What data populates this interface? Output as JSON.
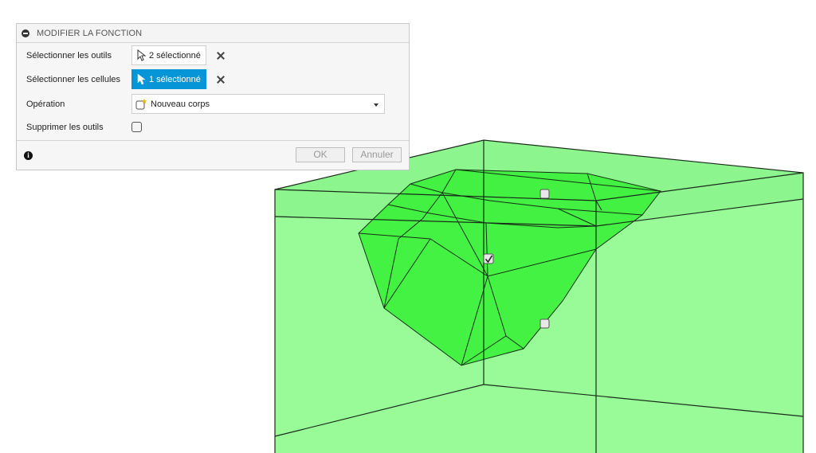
{
  "dialog": {
    "title": "MODIFIER LA FONCTION",
    "rows": {
      "tools": {
        "label": "Sélectionner les outils",
        "value": "2 sélectionné"
      },
      "cells": {
        "label": "Sélectionner les cellules",
        "value": "1 sélectionné"
      },
      "operation": {
        "label": "Opération",
        "value": "Nouveau corps"
      },
      "remove_tools": {
        "label": "Supprimer les outils",
        "checked": false
      }
    },
    "ok_label": "OK",
    "cancel_label": "Annuler"
  },
  "colors": {
    "accent": "#0696d7",
    "box_fill": "#98fb98",
    "inner_body_fill": "#33f533",
    "edge": "#1a2a1a"
  },
  "viewport": {
    "handles": [
      {
        "name": "cell-handle-top",
        "checked": false
      },
      {
        "name": "cell-handle-selected",
        "checked": true
      },
      {
        "name": "cell-handle-side",
        "checked": false
      }
    ]
  }
}
